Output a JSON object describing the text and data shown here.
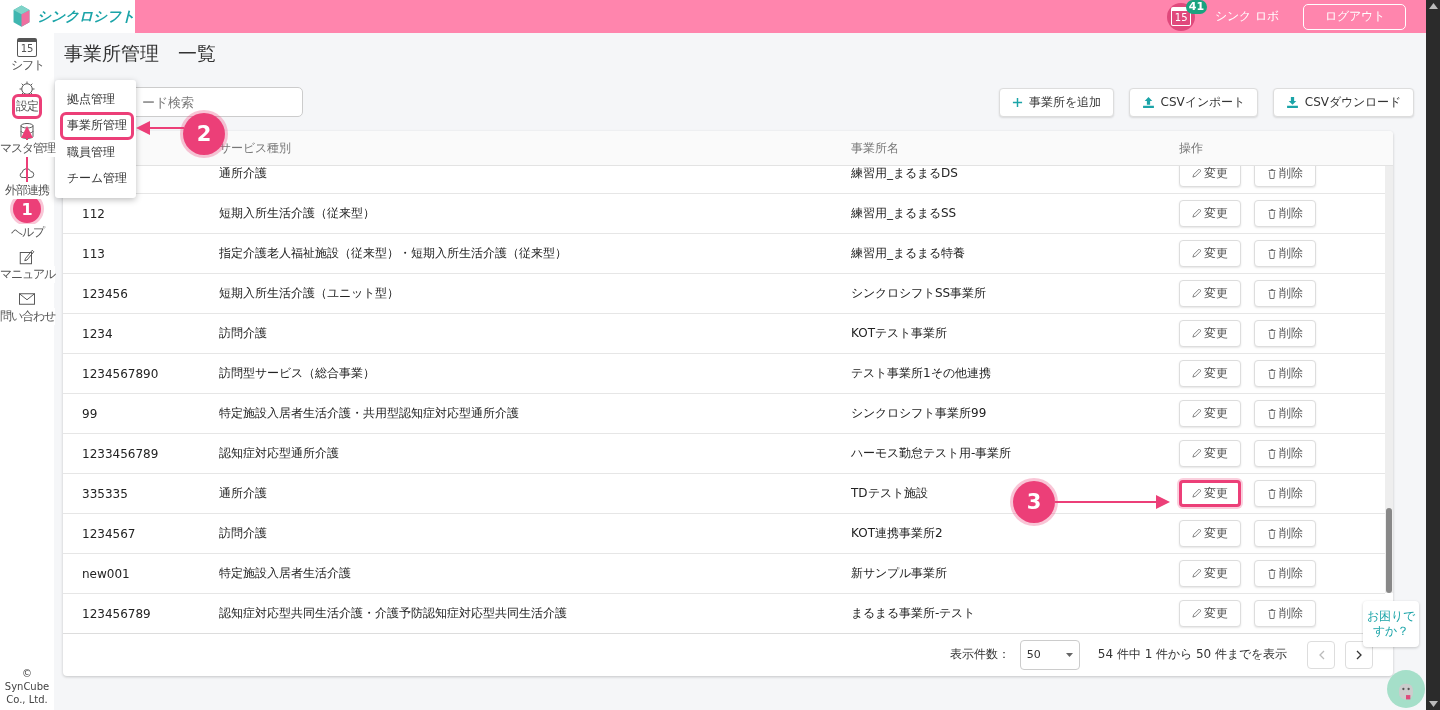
{
  "app": {
    "logo_text": "シンクロシフト",
    "notification_day": "15",
    "notification_count": "41",
    "user_name": "シンク ロボ",
    "logout": "ログアウト"
  },
  "sidebar": {
    "calendar_day": "15",
    "items": [
      {
        "kind": "calendar",
        "label": "シフト",
        "highlighted": false
      },
      {
        "kind": "gear",
        "label": "設定",
        "highlighted": true
      },
      {
        "kind": "database",
        "label": "マスタ管理",
        "highlighted": false
      },
      {
        "kind": "cloud",
        "label": "外部連携",
        "highlighted": false
      },
      {
        "kind": "help",
        "label": "ヘルプ",
        "highlighted": false
      },
      {
        "kind": "manual",
        "label": "マニュアル",
        "highlighted": false
      },
      {
        "kind": "mail",
        "label": "問い合わせ",
        "highlighted": false
      }
    ],
    "copyright": "© SynCube Co., Ltd."
  },
  "page_title": "事業所管理　一覧",
  "search": {
    "placeholder": "ード検索"
  },
  "actions": [
    {
      "kind": "add",
      "label": "事業所を追加"
    },
    {
      "kind": "upload",
      "label": "CSVインポート"
    },
    {
      "kind": "download",
      "label": "CSVダウンロード"
    }
  ],
  "settings_menu": [
    {
      "label": "拠点管理",
      "highlighted": false
    },
    {
      "label": "事業所管理",
      "highlighted": true
    },
    {
      "label": "職員管理",
      "highlighted": false
    },
    {
      "label": "チーム管理",
      "highlighted": false
    }
  ],
  "table": {
    "columns": [
      "サービス種別",
      "事業所名",
      "操作"
    ],
    "rows": [
      {
        "service": "通所介護",
        "name": "練習用_まるまるDS",
        "edit": "変更",
        "delete": "削除",
        "edit_highlighted": false
      },
      {
        "code": "112",
        "service": "短期入所生活介護（従来型）",
        "name": "練習用_まるまるSS",
        "edit": "変更",
        "delete": "削除",
        "edit_highlighted": false
      },
      {
        "code": "113",
        "service": "指定介護老人福祉施設（従来型）・短期入所生活介護（従来型）",
        "name": "練習用_まるまる特養",
        "edit": "変更",
        "delete": "削除",
        "edit_highlighted": false
      },
      {
        "code": "123456",
        "service": "短期入所生活介護（ユニット型）",
        "name": "シンクロシフトSS事業所",
        "edit": "変更",
        "delete": "削除",
        "edit_highlighted": false
      },
      {
        "code": "1234",
        "service": "訪問介護",
        "name": "KOTテスト事業所",
        "edit": "変更",
        "delete": "削除",
        "edit_highlighted": false
      },
      {
        "code": "1234567890",
        "service": "訪問型サービス（総合事業）",
        "name": "テスト事業所1その他連携",
        "edit": "変更",
        "delete": "削除",
        "edit_highlighted": false
      },
      {
        "code": "99",
        "service": "特定施設入居者生活介護・共用型認知症対応型通所介護",
        "name": "シンクロシフト事業所99",
        "edit": "変更",
        "delete": "削除",
        "edit_highlighted": false
      },
      {
        "code": "1233456789",
        "service": "認知症対応型通所介護",
        "name": "ハーモス勤怠テスト用-事業所",
        "edit": "変更",
        "delete": "削除",
        "edit_highlighted": false
      },
      {
        "code": "335335",
        "service": "通所介護",
        "name": "TDテスト施設",
        "edit": "変更",
        "delete": "削除",
        "edit_highlighted": true
      },
      {
        "code": "1234567",
        "service": "訪問介護",
        "name": "KOT連携事業所2",
        "edit": "変更",
        "delete": "削除",
        "edit_highlighted": false
      },
      {
        "code": "new001",
        "service": "特定施設入居者生活介護",
        "name": "新サンプル事業所",
        "edit": "変更",
        "delete": "削除",
        "edit_highlighted": false
      },
      {
        "code": "123456789",
        "service": "認知症対応型共同生活介護・介護予防認知症対応型共同生活介護",
        "name": "まるまる事業所-テスト",
        "edit": "変更",
        "delete": "削除",
        "edit_highlighted": false
      }
    ]
  },
  "pagination": {
    "page_size_label": "表示件数：",
    "page_size": "50",
    "summary": "54 件中 1 件から 50 件までを表示",
    "prev_disabled": true,
    "next_disabled": false
  },
  "help_bubble": [
    "お困りで",
    "すか？"
  ],
  "annotations": [
    {
      "label": "1"
    },
    {
      "label": "2"
    },
    {
      "label": "3"
    }
  ]
}
